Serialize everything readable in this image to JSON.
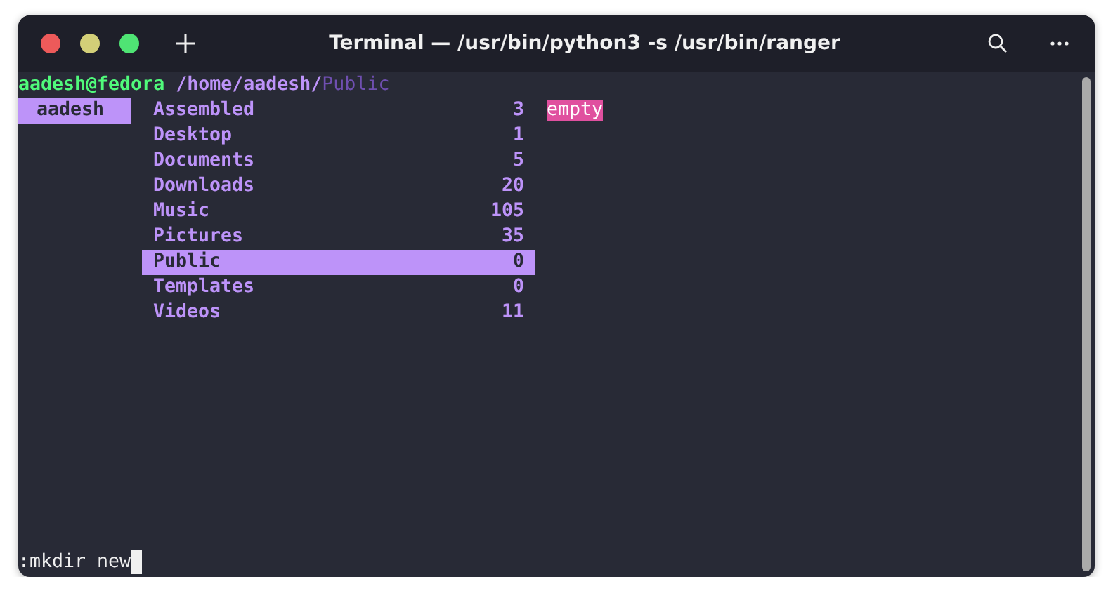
{
  "window": {
    "title": "Terminal — /usr/bin/python3 -s /usr/bin/ranger"
  },
  "path": {
    "user_host": "aadesh@fedora",
    "directory": "/home/aadesh/",
    "current": "Public"
  },
  "parent_column": [
    {
      "name": "aadesh",
      "selected": true
    }
  ],
  "files": [
    {
      "name": "Assembled",
      "count": "3",
      "selected": false
    },
    {
      "name": "Desktop",
      "count": "1",
      "selected": false
    },
    {
      "name": "Documents",
      "count": "5",
      "selected": false
    },
    {
      "name": "Downloads",
      "count": "20",
      "selected": false
    },
    {
      "name": "Music",
      "count": "105",
      "selected": false
    },
    {
      "name": "Pictures",
      "count": "35",
      "selected": false
    },
    {
      "name": "Public",
      "count": "0",
      "selected": true
    },
    {
      "name": "Templates",
      "count": "0",
      "selected": false
    },
    {
      "name": "Videos",
      "count": "11",
      "selected": false
    }
  ],
  "preview": {
    "text": "empty"
  },
  "command_line": {
    "text": ":mkdir new"
  }
}
